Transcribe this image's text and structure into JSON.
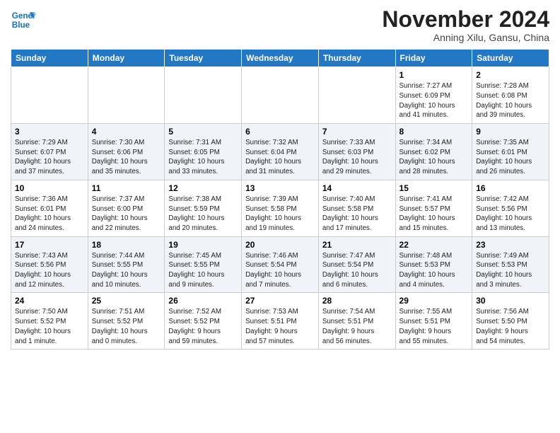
{
  "header": {
    "logo_line1": "General",
    "logo_line2": "Blue",
    "month_title": "November 2024",
    "location": "Anning Xilu, Gansu, China"
  },
  "weekdays": [
    "Sunday",
    "Monday",
    "Tuesday",
    "Wednesday",
    "Thursday",
    "Friday",
    "Saturday"
  ],
  "weeks": [
    [
      {
        "day": "",
        "info": ""
      },
      {
        "day": "",
        "info": ""
      },
      {
        "day": "",
        "info": ""
      },
      {
        "day": "",
        "info": ""
      },
      {
        "day": "",
        "info": ""
      },
      {
        "day": "1",
        "info": "Sunrise: 7:27 AM\nSunset: 6:09 PM\nDaylight: 10 hours\nand 41 minutes."
      },
      {
        "day": "2",
        "info": "Sunrise: 7:28 AM\nSunset: 6:08 PM\nDaylight: 10 hours\nand 39 minutes."
      }
    ],
    [
      {
        "day": "3",
        "info": "Sunrise: 7:29 AM\nSunset: 6:07 PM\nDaylight: 10 hours\nand 37 minutes."
      },
      {
        "day": "4",
        "info": "Sunrise: 7:30 AM\nSunset: 6:06 PM\nDaylight: 10 hours\nand 35 minutes."
      },
      {
        "day": "5",
        "info": "Sunrise: 7:31 AM\nSunset: 6:05 PM\nDaylight: 10 hours\nand 33 minutes."
      },
      {
        "day": "6",
        "info": "Sunrise: 7:32 AM\nSunset: 6:04 PM\nDaylight: 10 hours\nand 31 minutes."
      },
      {
        "day": "7",
        "info": "Sunrise: 7:33 AM\nSunset: 6:03 PM\nDaylight: 10 hours\nand 29 minutes."
      },
      {
        "day": "8",
        "info": "Sunrise: 7:34 AM\nSunset: 6:02 PM\nDaylight: 10 hours\nand 28 minutes."
      },
      {
        "day": "9",
        "info": "Sunrise: 7:35 AM\nSunset: 6:01 PM\nDaylight: 10 hours\nand 26 minutes."
      }
    ],
    [
      {
        "day": "10",
        "info": "Sunrise: 7:36 AM\nSunset: 6:01 PM\nDaylight: 10 hours\nand 24 minutes."
      },
      {
        "day": "11",
        "info": "Sunrise: 7:37 AM\nSunset: 6:00 PM\nDaylight: 10 hours\nand 22 minutes."
      },
      {
        "day": "12",
        "info": "Sunrise: 7:38 AM\nSunset: 5:59 PM\nDaylight: 10 hours\nand 20 minutes."
      },
      {
        "day": "13",
        "info": "Sunrise: 7:39 AM\nSunset: 5:58 PM\nDaylight: 10 hours\nand 19 minutes."
      },
      {
        "day": "14",
        "info": "Sunrise: 7:40 AM\nSunset: 5:58 PM\nDaylight: 10 hours\nand 17 minutes."
      },
      {
        "day": "15",
        "info": "Sunrise: 7:41 AM\nSunset: 5:57 PM\nDaylight: 10 hours\nand 15 minutes."
      },
      {
        "day": "16",
        "info": "Sunrise: 7:42 AM\nSunset: 5:56 PM\nDaylight: 10 hours\nand 13 minutes."
      }
    ],
    [
      {
        "day": "17",
        "info": "Sunrise: 7:43 AM\nSunset: 5:56 PM\nDaylight: 10 hours\nand 12 minutes."
      },
      {
        "day": "18",
        "info": "Sunrise: 7:44 AM\nSunset: 5:55 PM\nDaylight: 10 hours\nand 10 minutes."
      },
      {
        "day": "19",
        "info": "Sunrise: 7:45 AM\nSunset: 5:55 PM\nDaylight: 10 hours\nand 9 minutes."
      },
      {
        "day": "20",
        "info": "Sunrise: 7:46 AM\nSunset: 5:54 PM\nDaylight: 10 hours\nand 7 minutes."
      },
      {
        "day": "21",
        "info": "Sunrise: 7:47 AM\nSunset: 5:54 PM\nDaylight: 10 hours\nand 6 minutes."
      },
      {
        "day": "22",
        "info": "Sunrise: 7:48 AM\nSunset: 5:53 PM\nDaylight: 10 hours\nand 4 minutes."
      },
      {
        "day": "23",
        "info": "Sunrise: 7:49 AM\nSunset: 5:53 PM\nDaylight: 10 hours\nand 3 minutes."
      }
    ],
    [
      {
        "day": "24",
        "info": "Sunrise: 7:50 AM\nSunset: 5:52 PM\nDaylight: 10 hours\nand 1 minute."
      },
      {
        "day": "25",
        "info": "Sunrise: 7:51 AM\nSunset: 5:52 PM\nDaylight: 10 hours\nand 0 minutes."
      },
      {
        "day": "26",
        "info": "Sunrise: 7:52 AM\nSunset: 5:52 PM\nDaylight: 9 hours\nand 59 minutes."
      },
      {
        "day": "27",
        "info": "Sunrise: 7:53 AM\nSunset: 5:51 PM\nDaylight: 9 hours\nand 57 minutes."
      },
      {
        "day": "28",
        "info": "Sunrise: 7:54 AM\nSunset: 5:51 PM\nDaylight: 9 hours\nand 56 minutes."
      },
      {
        "day": "29",
        "info": "Sunrise: 7:55 AM\nSunset: 5:51 PM\nDaylight: 9 hours\nand 55 minutes."
      },
      {
        "day": "30",
        "info": "Sunrise: 7:56 AM\nSunset: 5:50 PM\nDaylight: 9 hours\nand 54 minutes."
      }
    ]
  ]
}
